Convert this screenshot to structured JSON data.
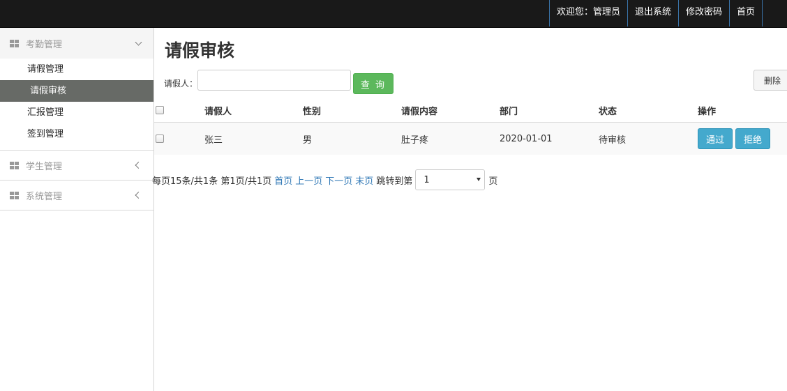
{
  "topnav": {
    "welcome": "欢迎您：管理员",
    "logout": "退出系统",
    "change_password": "修改密码",
    "home": "首页"
  },
  "sidebar": {
    "groups": [
      {
        "label": "考勤管理",
        "expanded": true,
        "items": [
          {
            "label": "请假管理"
          },
          {
            "label": "请假审核",
            "active": true
          },
          {
            "label": "汇报管理"
          },
          {
            "label": "签到管理"
          }
        ]
      },
      {
        "label": "学生管理",
        "expanded": false
      },
      {
        "label": "系统管理",
        "expanded": false
      }
    ]
  },
  "main": {
    "title": "请假审核",
    "search": {
      "label": "请假人：",
      "value": "",
      "button": "查 询"
    },
    "delete_button": "删除",
    "table": {
      "headers": [
        "请假人",
        "性别",
        "请假内容",
        "部门",
        "状态",
        "操作"
      ],
      "rows": [
        {
          "name": "张三",
          "gender": "男",
          "content": "肚子疼",
          "dept": "2020-01-01",
          "status": "待审核",
          "approve": "通过",
          "reject": "拒绝"
        }
      ]
    },
    "pager": {
      "summary": "每页15条/共1条 第1页/共1页",
      "first": "首页",
      "prev": "上一页",
      "next": "下一页",
      "last": "末页",
      "jump_prefix": "跳转到第",
      "selected_page": "1",
      "jump_suffix": "页"
    }
  },
  "colors": {
    "topbar": "#191919",
    "active_item": "#676a66",
    "query_button": "#5cb85c",
    "action_button": "#44a9cd"
  }
}
